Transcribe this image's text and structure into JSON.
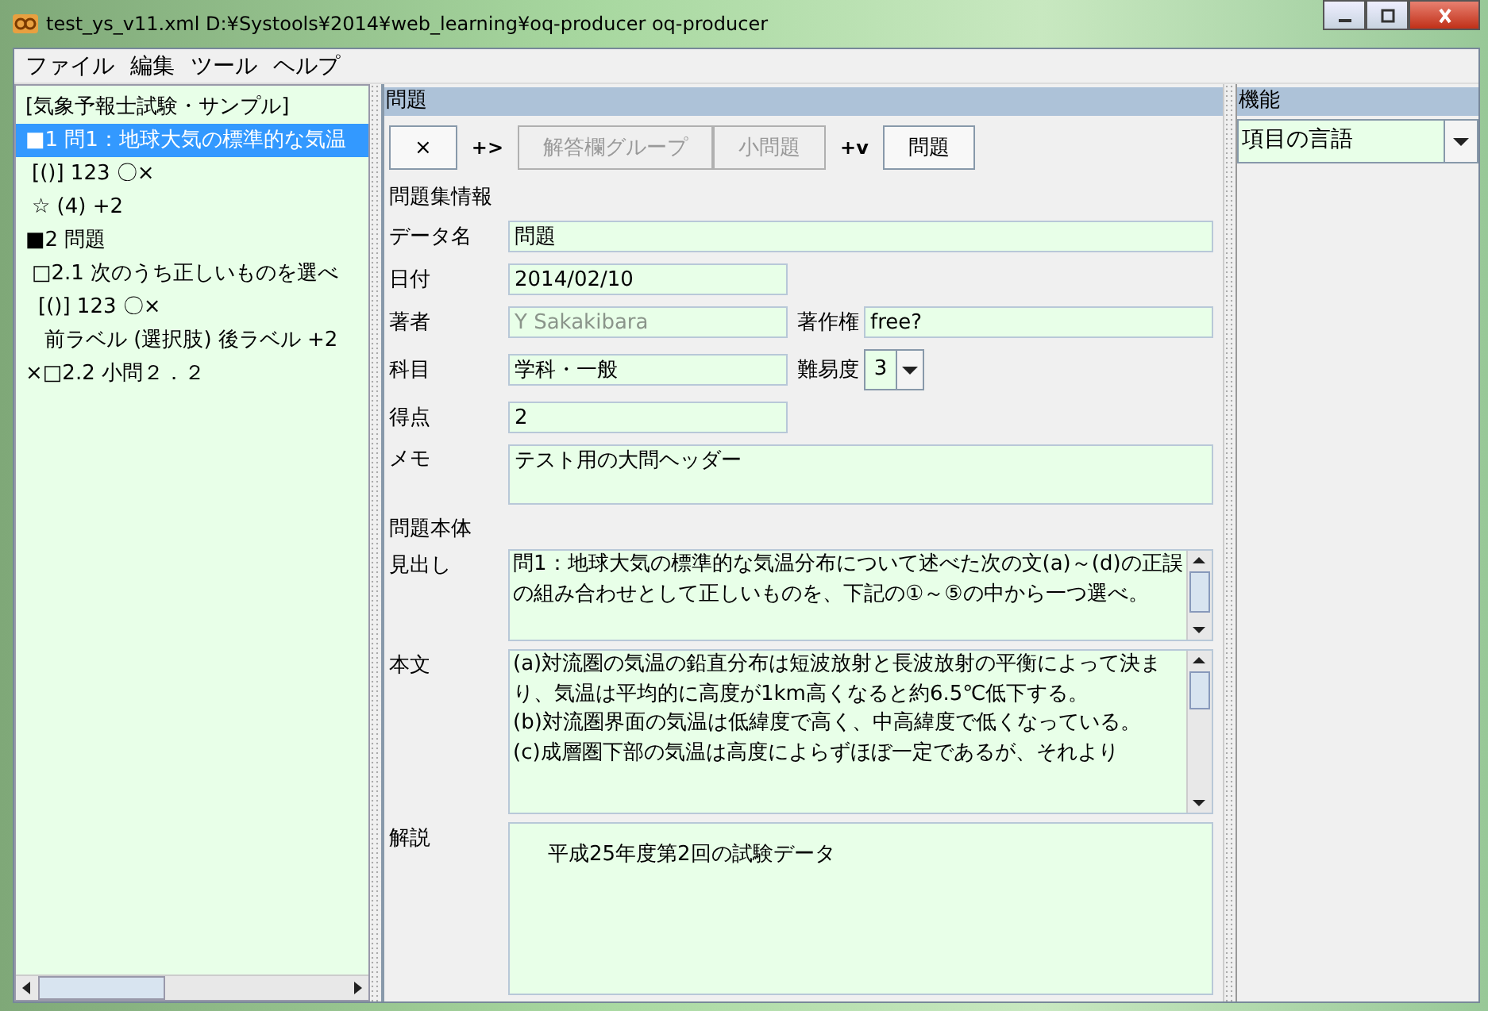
{
  "window": {
    "title": "test_ys_v11.xml  D:¥Systools¥2014¥web_learning¥oq-producer   oq-producer"
  },
  "menu": [
    "ファイル",
    "編集",
    "ツール",
    "ヘルプ"
  ],
  "tree": {
    "items": [
      {
        "label": "[気象予報士試験・サンプル]",
        "selected": false
      },
      {
        "label": "■1 問1：地球大気の標準的な気温",
        "selected": true,
        "children": [
          {
            "label": "[()] 123 〇×",
            "selected": false
          },
          {
            "label": "☆ (4)  +2",
            "selected": false
          }
        ]
      },
      {
        "label": "■2 問題",
        "selected": false,
        "children": [
          {
            "label": "□2.1 次のうち正しいものを選べ",
            "selected": false,
            "children": [
              {
                "label": "[()] 123 〇×",
                "selected": false,
                "children": [
                  {
                    "label": "前ラベル (選択肢) 後ラベル +2",
                    "selected": false
                  }
                ]
              }
            ]
          }
        ]
      },
      {
        "label": "×□2.2 小問２．２",
        "selected": false
      }
    ]
  },
  "editor": {
    "title": "問題",
    "toolbar": [
      {
        "kind": "button",
        "label": "×",
        "disabled": false
      },
      {
        "kind": "label",
        "label": "+>"
      },
      {
        "kind": "button",
        "label": "解答欄グループ",
        "disabled": true
      },
      {
        "kind": "button",
        "label": "小問題",
        "disabled": true
      },
      {
        "kind": "label",
        "label": "+v"
      },
      {
        "kind": "button",
        "label": "問題",
        "disabled": false
      }
    ],
    "info_heading": "問題集情報",
    "data_name": {
      "label": "データ名",
      "value": "問題"
    },
    "date": {
      "label": "日付",
      "value": "2014/02/10"
    },
    "author": {
      "label": "著者",
      "value": "Y Sakakibara"
    },
    "copyright": {
      "label": "著作権",
      "value": "free?"
    },
    "subject": {
      "label": "科目",
      "value": "学科・一般"
    },
    "difficulty": {
      "label": "難易度",
      "value": "3"
    },
    "score": {
      "label": "得点",
      "value": "2"
    },
    "memo": {
      "label": "メモ",
      "value": "テスト用の大問ヘッダー"
    },
    "body_heading": "問題本体",
    "heading": {
      "label": "見出し",
      "value": "問1：地球大気の標準的な気温分布について述べた次の文(a)～(d)の正誤の組み合わせとして正しいものを、下記の①～⑤の中から一つ選べ。"
    },
    "body": {
      "label": "本文",
      "value": "(a)対流圏の気温の鉛直分布は短波放射と長波放射の平衡によって決まり、気温は平均的に高度が1km高くなると約6.5℃低下する。\n(b)対流圏界面の気温は低緯度で高く、中高緯度で低くなっている。\n(c)成層圏下部の気温は高度によらずほぼ一定であるが、それより"
    },
    "explanation": {
      "label": "解説",
      "value": "平成25年度第2回の試験データ"
    }
  },
  "side": {
    "title": "機能",
    "dropdown": "項目の言語"
  }
}
